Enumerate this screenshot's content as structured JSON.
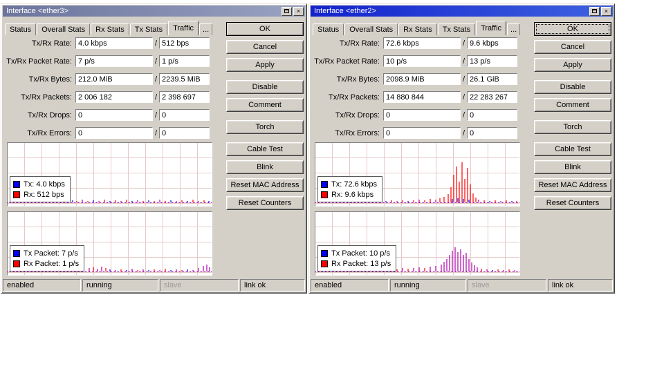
{
  "ui": {
    "separator": "/"
  },
  "icons": {
    "close": "×"
  },
  "windows": [
    {
      "title": "Interface <ether3>",
      "tabs": [
        "Status",
        "Overall Stats",
        "Rx Stats",
        "Tx Stats",
        "Traffic",
        "..."
      ],
      "active_tab": "Traffic",
      "fields": [
        {
          "label": "Tx/Rx Rate:",
          "tx": "4.0 kbps",
          "rx": "512 bps"
        },
        {
          "label": "Tx/Rx Packet Rate:",
          "tx": "7 p/s",
          "rx": "1 p/s"
        },
        {
          "label": "Tx/Rx Bytes:",
          "tx": "212.0 MiB",
          "rx": "2239.5 MiB"
        },
        {
          "label": "Tx/Rx Packets:",
          "tx": "2 006 182",
          "rx": "2 398 697"
        },
        {
          "label": "Tx/Rx Drops:",
          "tx": "0",
          "rx": "0"
        },
        {
          "label": "Tx/Rx Errors:",
          "tx": "0",
          "rx": "0"
        }
      ],
      "buttons": [
        "OK",
        "Cancel",
        "Apply",
        "Disable",
        "Comment",
        "Torch",
        "Cable Test",
        "Blink",
        "Reset MAC Address",
        "Reset Counters"
      ],
      "legend_rate": {
        "tx": "Tx:  4.0 kbps",
        "rx": "Rx:  512 bps"
      },
      "legend_packet": {
        "tx": "Tx Packet:  7 p/s",
        "rx": "Rx Packet:  1 p/s"
      },
      "status": [
        "enabled",
        "running",
        "slave",
        "link ok"
      ]
    },
    {
      "title": "Interface <ether2>",
      "tabs": [
        "Status",
        "Overall Stats",
        "Rx Stats",
        "Tx Stats",
        "Traffic",
        "..."
      ],
      "active_tab": "Traffic",
      "fields": [
        {
          "label": "Tx/Rx Rate:",
          "tx": "72.6 kbps",
          "rx": "9.6 kbps"
        },
        {
          "label": "Tx/Rx Packet Rate:",
          "tx": "10 p/s",
          "rx": "13 p/s"
        },
        {
          "label": "Tx/Rx Bytes:",
          "tx": "2098.9 MiB",
          "rx": "26.1 GiB"
        },
        {
          "label": "Tx/Rx Packets:",
          "tx": "14 880 844",
          "rx": "22 283 267"
        },
        {
          "label": "Tx/Rx Drops:",
          "tx": "0",
          "rx": "0"
        },
        {
          "label": "Tx/Rx Errors:",
          "tx": "0",
          "rx": "0"
        }
      ],
      "buttons": [
        "OK",
        "Cancel",
        "Apply",
        "Disable",
        "Comment",
        "Torch",
        "Cable Test",
        "Blink",
        "Reset MAC Address",
        "Reset Counters"
      ],
      "legend_rate": {
        "tx": "Tx:  72.6 kbps",
        "rx": "Rx:  9.6 kbps"
      },
      "legend_packet": {
        "tx": "Tx Packet:  10 p/s",
        "rx": "Rx Packet:  13 p/s"
      },
      "status": [
        "enabled",
        "running",
        "slave",
        "link ok"
      ]
    }
  ],
  "chart_data": [
    {
      "type": "bar",
      "title": "ether3 Tx/Rx rate history",
      "series": [
        {
          "name": "Tx",
          "value": "4.0 kbps",
          "color": "#0000ff"
        },
        {
          "name": "Rx",
          "value": "512 bps",
          "color": "#ff0000"
        }
      ],
      "spikes": [
        [
          4,
          2,
          "#ff0000"
        ],
        [
          10,
          1,
          "#0000ff"
        ],
        [
          16,
          3,
          "#aa00aa"
        ],
        [
          22,
          2,
          "#ff0000"
        ],
        [
          28,
          1,
          "#0000ff"
        ],
        [
          34,
          2,
          "#aa00aa"
        ],
        [
          40,
          3,
          "#ff0000"
        ],
        [
          46,
          1,
          "#0000ff"
        ],
        [
          52,
          2,
          "#ff0000"
        ],
        [
          58,
          3,
          "#aa00aa"
        ],
        [
          64,
          1,
          "#ff0000"
        ],
        [
          70,
          2,
          "#0000ff"
        ],
        [
          76,
          3,
          "#ff0000"
        ],
        [
          82,
          1,
          "#aa00aa"
        ],
        [
          88,
          2,
          "#ff0000"
        ],
        [
          94,
          3,
          "#0000ff"
        ],
        [
          100,
          2,
          "#ff0000"
        ],
        [
          108,
          4,
          "#aa00aa"
        ],
        [
          116,
          2,
          "#ff0000"
        ],
        [
          124,
          3,
          "#0000ff"
        ],
        [
          132,
          2,
          "#aa00aa"
        ],
        [
          140,
          4,
          "#ff0000"
        ],
        [
          148,
          2,
          "#0000ff"
        ],
        [
          156,
          3,
          "#ff0000"
        ],
        [
          164,
          2,
          "#aa00aa"
        ],
        [
          172,
          4,
          "#ff0000"
        ],
        [
          180,
          2,
          "#0000ff"
        ],
        [
          188,
          3,
          "#aa00aa"
        ],
        [
          196,
          2,
          "#ff0000"
        ],
        [
          204,
          3,
          "#0000ff"
        ],
        [
          212,
          2,
          "#ff0000"
        ],
        [
          220,
          4,
          "#aa00aa"
        ],
        [
          228,
          2,
          "#ff0000"
        ],
        [
          236,
          3,
          "#0000ff"
        ],
        [
          244,
          2,
          "#aa00aa"
        ],
        [
          252,
          3,
          "#ff0000"
        ],
        [
          260,
          2,
          "#0000ff"
        ],
        [
          268,
          4,
          "#ff0000"
        ],
        [
          276,
          2,
          "#aa00aa"
        ],
        [
          284,
          3,
          "#ff0000"
        ],
        [
          291,
          2,
          "#0000ff"
        ]
      ]
    },
    {
      "type": "bar",
      "title": "ether3 Tx/Rx packet rate history",
      "series": [
        {
          "name": "Tx Packet",
          "value": "7 p/s",
          "color": "#0000ff"
        },
        {
          "name": "Rx Packet",
          "value": "1 p/s",
          "color": "#ff0000"
        }
      ],
      "spikes": [
        [
          5,
          2,
          "#aa00aa"
        ],
        [
          12,
          1,
          "#ff0000"
        ],
        [
          19,
          2,
          "#0000ff"
        ],
        [
          26,
          3,
          "#aa00aa"
        ],
        [
          33,
          1,
          "#ff0000"
        ],
        [
          40,
          2,
          "#aa00aa"
        ],
        [
          47,
          3,
          "#ff0000"
        ],
        [
          54,
          2,
          "#0000ff"
        ],
        [
          61,
          1,
          "#aa00aa"
        ],
        [
          68,
          2,
          "#ff0000"
        ],
        [
          75,
          3,
          "#aa00aa"
        ],
        [
          82,
          2,
          "#0000ff"
        ],
        [
          89,
          1,
          "#ff0000"
        ],
        [
          96,
          2,
          "#aa00aa"
        ],
        [
          103,
          3,
          "#ff0000"
        ],
        [
          110,
          2,
          "#0000ff"
        ],
        [
          118,
          5,
          "#aa00aa"
        ],
        [
          124,
          6,
          "#ff0000"
        ],
        [
          130,
          4,
          "#aa00aa"
        ],
        [
          136,
          7,
          "#aa00aa"
        ],
        [
          142,
          5,
          "#ff0000"
        ],
        [
          148,
          3,
          "#0000ff"
        ],
        [
          156,
          2,
          "#aa00aa"
        ],
        [
          164,
          3,
          "#ff0000"
        ],
        [
          172,
          2,
          "#0000ff"
        ],
        [
          180,
          4,
          "#aa00aa"
        ],
        [
          188,
          2,
          "#ff0000"
        ],
        [
          196,
          3,
          "#aa00aa"
        ],
        [
          204,
          2,
          "#0000ff"
        ],
        [
          212,
          3,
          "#ff0000"
        ],
        [
          220,
          2,
          "#aa00aa"
        ],
        [
          228,
          4,
          "#ff0000"
        ],
        [
          236,
          2,
          "#0000ff"
        ],
        [
          244,
          3,
          "#aa00aa"
        ],
        [
          252,
          2,
          "#ff0000"
        ],
        [
          260,
          3,
          "#0000ff"
        ],
        [
          268,
          2,
          "#aa00aa"
        ],
        [
          276,
          5,
          "#aa00aa"
        ],
        [
          283,
          8,
          "#aa00aa"
        ],
        [
          288,
          10,
          "#aa00aa"
        ],
        [
          292,
          6,
          "#aa00aa"
        ]
      ]
    },
    {
      "type": "bar",
      "title": "ether2 Tx/Rx rate history",
      "series": [
        {
          "name": "Tx",
          "value": "72.6 kbps",
          "color": "#0000ff"
        },
        {
          "name": "Rx",
          "value": "9.6 kbps",
          "color": "#ff0000"
        }
      ],
      "spikes": [
        [
          6,
          2,
          "#ff0000"
        ],
        [
          14,
          1,
          "#0000ff"
        ],
        [
          22,
          2,
          "#aa00aa"
        ],
        [
          30,
          3,
          "#ff0000"
        ],
        [
          38,
          1,
          "#0000ff"
        ],
        [
          46,
          2,
          "#ff0000"
        ],
        [
          54,
          3,
          "#aa00aa"
        ],
        [
          62,
          2,
          "#ff0000"
        ],
        [
          70,
          1,
          "#0000ff"
        ],
        [
          78,
          2,
          "#ff0000"
        ],
        [
          86,
          3,
          "#aa00aa"
        ],
        [
          94,
          2,
          "#ff0000"
        ],
        [
          102,
          2,
          "#0000ff"
        ],
        [
          110,
          3,
          "#ff0000"
        ],
        [
          118,
          2,
          "#aa00aa"
        ],
        [
          126,
          3,
          "#ff0000"
        ],
        [
          134,
          2,
          "#0000ff"
        ],
        [
          142,
          3,
          "#ff0000"
        ],
        [
          150,
          4,
          "#aa00aa"
        ],
        [
          158,
          3,
          "#ff0000"
        ],
        [
          166,
          5,
          "#ff0000"
        ],
        [
          174,
          4,
          "#aa00aa"
        ],
        [
          180,
          6,
          "#ff0000"
        ],
        [
          186,
          8,
          "#ff0000"
        ],
        [
          192,
          12,
          "#ff0000"
        ],
        [
          196,
          22,
          "#ff0000"
        ],
        [
          198,
          5,
          "#0000ff"
        ],
        [
          200,
          40,
          "#ff0000"
        ],
        [
          204,
          52,
          "#ff0000"
        ],
        [
          206,
          6,
          "#0000ff"
        ],
        [
          208,
          30,
          "#ff0000"
        ],
        [
          212,
          58,
          "#ff0000"
        ],
        [
          214,
          5,
          "#0000ff"
        ],
        [
          216,
          34,
          "#ff0000"
        ],
        [
          220,
          50,
          "#ff0000"
        ],
        [
          222,
          4,
          "#0000ff"
        ],
        [
          224,
          26,
          "#ff0000"
        ],
        [
          228,
          13,
          "#ff0000"
        ],
        [
          232,
          7,
          "#ff0000"
        ],
        [
          236,
          4,
          "#aa00aa"
        ],
        [
          244,
          3,
          "#ff0000"
        ],
        [
          252,
          2,
          "#0000ff"
        ],
        [
          260,
          3,
          "#ff0000"
        ],
        [
          268,
          2,
          "#aa00aa"
        ],
        [
          276,
          3,
          "#ff0000"
        ],
        [
          284,
          2,
          "#0000ff"
        ],
        [
          291,
          2,
          "#ff0000"
        ]
      ]
    },
    {
      "type": "bar",
      "title": "ether2 Tx/Rx packet rate history",
      "series": [
        {
          "name": "Tx Packet",
          "value": "10 p/s",
          "color": "#0000ff"
        },
        {
          "name": "Rx Packet",
          "value": "13 p/s",
          "color": "#ff0000"
        }
      ],
      "spikes": [
        [
          6,
          2,
          "#aa00aa"
        ],
        [
          14,
          3,
          "#ff0000"
        ],
        [
          22,
          2,
          "#0000ff"
        ],
        [
          30,
          3,
          "#aa00aa"
        ],
        [
          38,
          2,
          "#ff0000"
        ],
        [
          46,
          3,
          "#aa00aa"
        ],
        [
          54,
          2,
          "#0000ff"
        ],
        [
          62,
          4,
          "#ff0000"
        ],
        [
          70,
          3,
          "#aa00aa"
        ],
        [
          78,
          2,
          "#ff0000"
        ],
        [
          86,
          4,
          "#aa00aa"
        ],
        [
          94,
          3,
          "#0000ff"
        ],
        [
          102,
          2,
          "#ff0000"
        ],
        [
          110,
          4,
          "#aa00aa"
        ],
        [
          118,
          3,
          "#ff0000"
        ],
        [
          126,
          5,
          "#aa00aa"
        ],
        [
          134,
          4,
          "#ff0000"
        ],
        [
          142,
          5,
          "#aa00aa"
        ],
        [
          150,
          6,
          "#aa00aa"
        ],
        [
          158,
          5,
          "#ff0000"
        ],
        [
          166,
          7,
          "#aa00aa"
        ],
        [
          174,
          8,
          "#aa00aa"
        ],
        [
          182,
          10,
          "#aa00aa"
        ],
        [
          186,
          14,
          "#aa00aa"
        ],
        [
          190,
          18,
          "#aa00aa"
        ],
        [
          194,
          24,
          "#aa00aa"
        ],
        [
          198,
          30,
          "#aa00aa"
        ],
        [
          202,
          35,
          "#aa00aa"
        ],
        [
          206,
          28,
          "#aa00aa"
        ],
        [
          210,
          32,
          "#aa00aa"
        ],
        [
          214,
          24,
          "#aa00aa"
        ],
        [
          218,
          27,
          "#aa00aa"
        ],
        [
          222,
          18,
          "#aa00aa"
        ],
        [
          226,
          13,
          "#aa00aa"
        ],
        [
          230,
          9,
          "#aa00aa"
        ],
        [
          234,
          6,
          "#aa00aa"
        ],
        [
          240,
          4,
          "#ff0000"
        ],
        [
          248,
          3,
          "#aa00aa"
        ],
        [
          256,
          2,
          "#0000ff"
        ],
        [
          264,
          3,
          "#ff0000"
        ],
        [
          272,
          2,
          "#aa00aa"
        ],
        [
          280,
          3,
          "#ff0000"
        ],
        [
          288,
          2,
          "#aa00aa"
        ]
      ]
    }
  ]
}
